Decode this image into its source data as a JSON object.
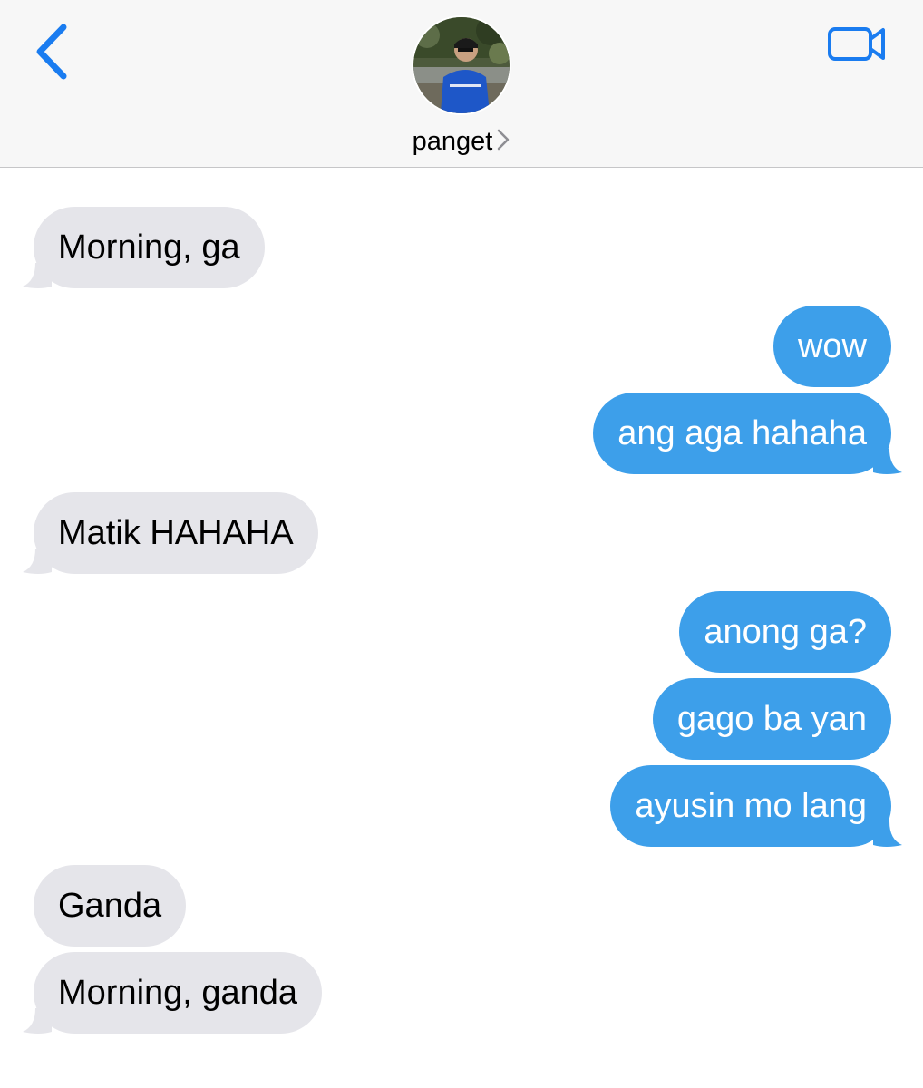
{
  "colors": {
    "accent": "#1a7cf0",
    "incoming_bubble": "#e5e5ea",
    "outgoing_bubble": "#3d9fea",
    "header_bg": "#f7f7f7"
  },
  "header": {
    "back_icon": "chevron-left-icon",
    "video_icon": "video-camera-icon",
    "contact_name": "panget",
    "contact_chevron_icon": "chevron-right-icon"
  },
  "messages": [
    {
      "direction": "incoming",
      "text": "Morning, ga",
      "tail": true
    },
    {
      "direction": "outgoing",
      "text": "wow",
      "tail": false
    },
    {
      "direction": "outgoing",
      "text": "ang aga hahaha",
      "tail": true
    },
    {
      "direction": "incoming",
      "text": "Matik HAHAHA",
      "tail": true
    },
    {
      "direction": "outgoing",
      "text": "anong ga?",
      "tail": false
    },
    {
      "direction": "outgoing",
      "text": "gago ba yan",
      "tail": false
    },
    {
      "direction": "outgoing",
      "text": "ayusin mo lang",
      "tail": true
    },
    {
      "direction": "incoming",
      "text": "Ganda",
      "tail": false
    },
    {
      "direction": "incoming",
      "text": "Morning, ganda",
      "tail": true
    }
  ]
}
